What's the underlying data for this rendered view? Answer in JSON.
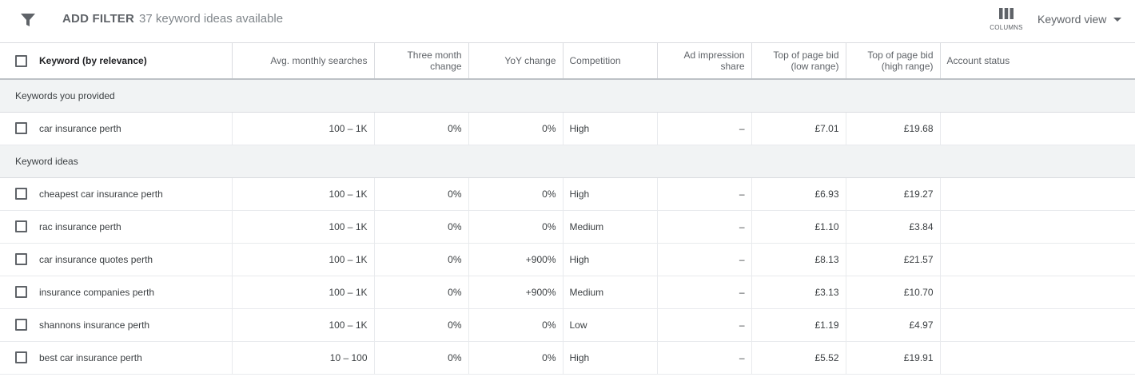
{
  "toolbar": {
    "filter_icon": "filter-icon",
    "add_filter_label": "ADD FILTER",
    "ideas_count": "37 keyword ideas available",
    "columns_icon": "columns-icon",
    "columns_label": "COLUMNS",
    "view_label": "Keyword view",
    "view_caret_icon": "caret-down-icon"
  },
  "table": {
    "headers": {
      "keyword": "Keyword (by relevance)",
      "avg_searches": "Avg. monthly searches",
      "three_month_1": "Three month",
      "three_month_2": "change",
      "yoy": "YoY change",
      "competition": "Competition",
      "ad_impr_1": "Ad impression",
      "ad_impr_2": "share",
      "bid_low_1": "Top of page bid",
      "bid_low_2": "(low range)",
      "bid_high_1": "Top of page bid",
      "bid_high_2": "(high range)",
      "account_status": "Account status"
    },
    "groups": [
      {
        "label": "Keywords you provided",
        "rows": [
          {
            "keyword": "car insurance perth",
            "searches": "100 – 1K",
            "three_month": "0%",
            "yoy": "0%",
            "competition": "High",
            "ad_share": "–",
            "bid_low": "£7.01",
            "bid_high": "£19.68",
            "status": ""
          }
        ]
      },
      {
        "label": "Keyword ideas",
        "rows": [
          {
            "keyword": "cheapest car insurance perth",
            "searches": "100 – 1K",
            "three_month": "0%",
            "yoy": "0%",
            "competition": "High",
            "ad_share": "–",
            "bid_low": "£6.93",
            "bid_high": "£19.27",
            "status": ""
          },
          {
            "keyword": "rac insurance perth",
            "searches": "100 – 1K",
            "three_month": "0%",
            "yoy": "0%",
            "competition": "Medium",
            "ad_share": "–",
            "bid_low": "£1.10",
            "bid_high": "£3.84",
            "status": ""
          },
          {
            "keyword": "car insurance quotes perth",
            "searches": "100 – 1K",
            "three_month": "0%",
            "yoy": "+900%",
            "competition": "High",
            "ad_share": "–",
            "bid_low": "£8.13",
            "bid_high": "£21.57",
            "status": ""
          },
          {
            "keyword": "insurance companies perth",
            "searches": "100 – 1K",
            "three_month": "0%",
            "yoy": "+900%",
            "competition": "Medium",
            "ad_share": "–",
            "bid_low": "£3.13",
            "bid_high": "£10.70",
            "status": ""
          },
          {
            "keyword": "shannons insurance perth",
            "searches": "100 – 1K",
            "three_month": "0%",
            "yoy": "0%",
            "competition": "Low",
            "ad_share": "–",
            "bid_low": "£1.19",
            "bid_high": "£4.97",
            "status": ""
          },
          {
            "keyword": "best car insurance perth",
            "searches": "10 – 100",
            "three_month": "0%",
            "yoy": "0%",
            "competition": "High",
            "ad_share": "–",
            "bid_low": "£5.52",
            "bid_high": "£19.91",
            "status": ""
          }
        ]
      }
    ]
  }
}
